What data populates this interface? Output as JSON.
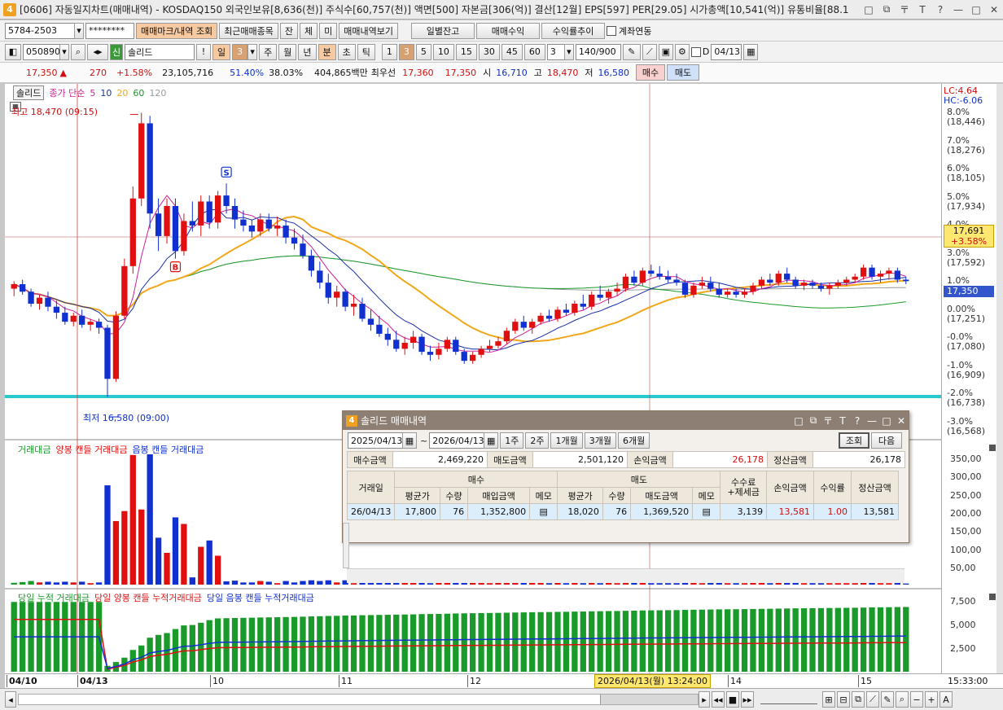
{
  "window": {
    "badge": "4",
    "title": "[0606] 자동일지차트(매매내역) - KOSDAQ150 외국인보유[8,636(천)] 주식수[60,757(천)] 액면[500] 자본금[306(억)] 결산[12월] EPS[597] PER[29.05] 시가총액[10,541(억)] 유통비율[88.1",
    "controls": [
      "□",
      "⧉",
      "〒",
      "T",
      "?",
      "—",
      "□",
      "✕"
    ]
  },
  "toolbar1": {
    "account": "5784-2503",
    "password": "********",
    "tab_mark": "매매마크/내역",
    "query": "조회",
    "recent": "최근매매종목",
    "tab_jan": "잔",
    "tab_che": "체",
    "tab_mi": "미",
    "view_trades": "매매내역보기",
    "daily_balance": "일별잔고",
    "trade_profit": "매매수익",
    "return_trend": "수익률추이",
    "account_link": "계좌연동"
  },
  "toolbar2": {
    "code": "050890",
    "badge": "신",
    "stock_name": "솔리드",
    "periods": [
      "일",
      "3",
      "주",
      "월",
      "년",
      "분",
      "초",
      "틱"
    ],
    "minutes": [
      "1",
      "3",
      "5",
      "10",
      "15",
      "30",
      "45",
      "60"
    ],
    "interval": "3",
    "count": "140",
    "count_total": "/900",
    "d_label": "D",
    "date": "04/13"
  },
  "quote": {
    "price": "17,350",
    "arrow": "▲",
    "change": "270",
    "change_pct": "+1.58%",
    "volume": "23,105,716",
    "ratio1": "51.40%",
    "ratio2": "38.03%",
    "amount": "404,865백만",
    "best_label": "최우선",
    "best_ask": "17,360",
    "best_bid": "17,350",
    "open_label": "시",
    "open": "16,710",
    "high_label": "고",
    "high": "18,470",
    "low_label": "저",
    "low": "16,580",
    "buy_btn": "매수",
    "sell_btn": "매도"
  },
  "legend": {
    "name": "솔리드",
    "close_simple": "종가 단순",
    "ma5": "5",
    "ma10": "10",
    "ma20": "20",
    "ma60": "60",
    "ma120": "120",
    "high_mark": "최고 18,470 (09:15)",
    "low_mark": "최저 16,580 (09:00)",
    "buy_marker": "B",
    "sell_marker": "S",
    "colors": {
      "ma5": "#d0209a",
      "ma10": "#1a2fa8",
      "ma20": "#f0a81a",
      "ma60": "#1a9a2a",
      "ma120": "#888888",
      "up": "#e01010",
      "down": "#1030d0"
    }
  },
  "price_axis": {
    "lc": "LC:4.64",
    "hc": "HC:-6.06",
    "ticks": [
      {
        "pct": "8.0%",
        "price": "(18,446)"
      },
      {
        "pct": "7.0%",
        "price": "(18,276)"
      },
      {
        "pct": "6.0%",
        "price": "(18,105)"
      },
      {
        "pct": "5.0%",
        "price": "(17,934)"
      },
      {
        "pct": "4.0%",
        "price": ""
      },
      {
        "pct": "3.0%",
        "price": "(17,592)"
      },
      {
        "pct": "1.0%",
        "price": ""
      },
      {
        "pct": "0.00%",
        "price": "(17,251)"
      },
      {
        "pct": "-0.0%",
        "price": "(17,080)"
      },
      {
        "pct": "-1.0%",
        "price": "(16,909)"
      },
      {
        "pct": "-2.0%",
        "price": "(16,738)"
      },
      {
        "pct": "-3.0%",
        "price": "(16,568)"
      }
    ],
    "cursor_price": "17,691",
    "cursor_pct": "+3.58%",
    "last_price": "17,350"
  },
  "volume_panel": {
    "title_all": "거래대금",
    "title_up": "양봉 캔들 거래대금",
    "title_down": "음봉 캔들 거래대금",
    "ticks": [
      "350,00",
      "300,00",
      "250,00",
      "200,00",
      "150,00",
      "100,00",
      "50,00"
    ]
  },
  "cum_panel": {
    "title_all": "당일 누적 거래대금",
    "title_up": "당일 양봉 캔들 누적거래대금",
    "title_down": "당일 음봉 캔들 누적거래대금",
    "ticks": [
      "7,500",
      "5,000",
      "2,500"
    ]
  },
  "time_axis": {
    "labels": [
      "04/10",
      "04/13",
      "10",
      "11",
      "12",
      "14",
      "15"
    ],
    "cursor_time": "2026/04/13(월) 13:24:00",
    "right_time": "15:33:00"
  },
  "popup": {
    "badge": "4",
    "title": "솔리드 매매내역",
    "date_from": "2025/04/13",
    "tilde": "~",
    "date_to": "2026/04/13",
    "ranges": [
      "1주",
      "2주",
      "1개월",
      "3개월",
      "6개월"
    ],
    "query": "조회",
    "next": "다음",
    "summary": {
      "buy_amt_label": "매수금액",
      "buy_amt": "2,469,220",
      "sell_amt_label": "매도금액",
      "sell_amt": "2,501,120",
      "pnl_label": "손익금액",
      "pnl": "26,178",
      "settle_label": "정산금액",
      "settle": "26,178"
    },
    "headers": {
      "date": "거래일",
      "buy": "매수",
      "sell": "매도",
      "fee1": "수수료",
      "fee2": "+제세금",
      "pnl": "손익금액",
      "ret": "수익률",
      "settle": "정산금액",
      "avg": "평균가",
      "qty": "수량",
      "buy_amt": "매입금액",
      "memo": "메모",
      "sell_avg": "평균가",
      "sell_qty": "수량",
      "sell_amt": "매도금액",
      "sell_memo": "메모"
    },
    "rows": [
      {
        "date": "26/04/13",
        "buy_avg": "17,800",
        "buy_qty": "76",
        "buy_amt": "1,352,800",
        "sell_avg": "18,020",
        "sell_qty": "76",
        "sell_amt": "1,369,520",
        "fee": "3,139",
        "pnl": "13,581",
        "ret": "1.00",
        "settle": "13,581"
      }
    ]
  },
  "chart_data": {
    "type": "candlestick",
    "interval": "3분",
    "candles": [
      [
        17300,
        17350,
        17250,
        17330
      ],
      [
        17330,
        17360,
        17260,
        17280
      ],
      [
        17280,
        17300,
        17180,
        17200
      ],
      [
        17200,
        17260,
        17160,
        17240
      ],
      [
        17240,
        17280,
        17150,
        17180
      ],
      [
        17180,
        17220,
        17100,
        17140
      ],
      [
        17140,
        17180,
        17060,
        17080
      ],
      [
        17080,
        17140,
        17050,
        17120
      ],
      [
        17120,
        17160,
        17040,
        17060
      ],
      [
        17060,
        17100,
        17020,
        17080
      ],
      [
        17080,
        17100,
        17000,
        17040
      ],
      [
        17040,
        17060,
        16580,
        16700
      ],
      [
        16700,
        17150,
        16680,
        17120
      ],
      [
        17120,
        17500,
        17100,
        17450
      ],
      [
        17450,
        17980,
        17400,
        17900
      ],
      [
        17900,
        18470,
        17850,
        18400
      ],
      [
        18400,
        18450,
        17700,
        17800
      ],
      [
        17800,
        17900,
        17550,
        17650
      ],
      [
        17650,
        17900,
        17600,
        17850
      ],
      [
        17850,
        17900,
        17500,
        17550
      ],
      [
        17550,
        17800,
        17520,
        17750
      ],
      [
        17750,
        17880,
        17680,
        17720
      ],
      [
        17720,
        17920,
        17650,
        17880
      ],
      [
        17880,
        17920,
        17700,
        17740
      ],
      [
        17740,
        17950,
        17700,
        17920
      ],
      [
        17920,
        18000,
        17800,
        17850
      ],
      [
        17850,
        17900,
        17700,
        17760
      ],
      [
        17760,
        17820,
        17680,
        17720
      ],
      [
        17720,
        17760,
        17640,
        17680
      ],
      [
        17680,
        17800,
        17650,
        17760
      ],
      [
        17760,
        17800,
        17680,
        17700
      ],
      [
        17700,
        17780,
        17650,
        17720
      ],
      [
        17720,
        17760,
        17600,
        17640
      ],
      [
        17640,
        17700,
        17560,
        17600
      ],
      [
        17600,
        17660,
        17500,
        17520
      ],
      [
        17520,
        17560,
        17380,
        17420
      ],
      [
        17420,
        17480,
        17300,
        17340
      ],
      [
        17340,
        17400,
        17200,
        17240
      ],
      [
        17240,
        17320,
        17180,
        17280
      ],
      [
        17280,
        17300,
        17150,
        17180
      ],
      [
        17180,
        17260,
        17120,
        17200
      ],
      [
        17200,
        17240,
        17080,
        17100
      ],
      [
        17100,
        17160,
        17020,
        17060
      ],
      [
        17060,
        17120,
        16980,
        17000
      ],
      [
        17000,
        17040,
        16920,
        16960
      ],
      [
        16960,
        17020,
        16880,
        16900
      ],
      [
        16900,
        16980,
        16860,
        16940
      ],
      [
        16940,
        17020,
        16900,
        16980
      ],
      [
        16980,
        17000,
        16860,
        16880
      ],
      [
        16880,
        16920,
        16820,
        16860
      ],
      [
        16860,
        16940,
        16830,
        16900
      ],
      [
        16900,
        16980,
        16880,
        16960
      ],
      [
        16960,
        16980,
        16860,
        16880
      ],
      [
        16880,
        16900,
        16800,
        16820
      ],
      [
        16820,
        16880,
        16800,
        16860
      ],
      [
        16860,
        16920,
        16840,
        16900
      ],
      [
        16900,
        16960,
        16880,
        16920
      ],
      [
        16920,
        16980,
        16900,
        16950
      ],
      [
        16950,
        17040,
        16930,
        17020
      ],
      [
        17020,
        17100,
        17000,
        17080
      ],
      [
        17080,
        17120,
        17020,
        17040
      ],
      [
        17040,
        17100,
        17000,
        17080
      ],
      [
        17080,
        17140,
        17060,
        17120
      ],
      [
        17120,
        17160,
        17080,
        17100
      ],
      [
        17100,
        17180,
        17080,
        17160
      ],
      [
        17160,
        17200,
        17120,
        17140
      ],
      [
        17140,
        17220,
        17120,
        17200
      ],
      [
        17200,
        17260,
        17160,
        17180
      ],
      [
        17180,
        17280,
        17160,
        17260
      ],
      [
        17260,
        17320,
        17220,
        17240
      ],
      [
        17240,
        17300,
        17200,
        17280
      ],
      [
        17280,
        17340,
        17250,
        17300
      ],
      [
        17300,
        17400,
        17280,
        17380
      ],
      [
        17380,
        17420,
        17320,
        17340
      ],
      [
        17340,
        17440,
        17320,
        17420
      ],
      [
        17420,
        17460,
        17380,
        17400
      ],
      [
        17400,
        17450,
        17360,
        17380
      ],
      [
        17380,
        17420,
        17340,
        17360
      ],
      [
        17360,
        17400,
        17320,
        17340
      ],
      [
        17340,
        17360,
        17240,
        17260
      ],
      [
        17260,
        17340,
        17240,
        17320
      ],
      [
        17320,
        17380,
        17300,
        17340
      ],
      [
        17340,
        17380,
        17280,
        17300
      ],
      [
        17300,
        17340,
        17240,
        17260
      ],
      [
        17260,
        17300,
        17240,
        17280
      ],
      [
        17280,
        17300,
        17240,
        17260
      ],
      [
        17260,
        17300,
        17240,
        17280
      ],
      [
        17280,
        17340,
        17260,
        17320
      ],
      [
        17320,
        17380,
        17300,
        17360
      ],
      [
        17360,
        17400,
        17320,
        17340
      ],
      [
        17340,
        17420,
        17320,
        17400
      ],
      [
        17400,
        17440,
        17340,
        17360
      ],
      [
        17360,
        17380,
        17300,
        17320
      ],
      [
        17320,
        17360,
        17290,
        17340
      ],
      [
        17340,
        17360,
        17300,
        17320
      ],
      [
        17320,
        17340,
        17280,
        17300
      ],
      [
        17300,
        17340,
        17260,
        17320
      ],
      [
        17320,
        17360,
        17300,
        17340
      ],
      [
        17340,
        17380,
        17320,
        17360
      ],
      [
        17360,
        17400,
        17340,
        17380
      ],
      [
        17380,
        17460,
        17360,
        17440
      ],
      [
        17440,
        17460,
        17360,
        17380
      ],
      [
        17380,
        17420,
        17340,
        17400
      ],
      [
        17400,
        17440,
        17360,
        17420
      ],
      [
        17420,
        17440,
        17340,
        17360
      ],
      [
        17360,
        17380,
        17330,
        17350
      ]
    ],
    "buy_marker_index": 19,
    "sell_marker_index": 25
  }
}
